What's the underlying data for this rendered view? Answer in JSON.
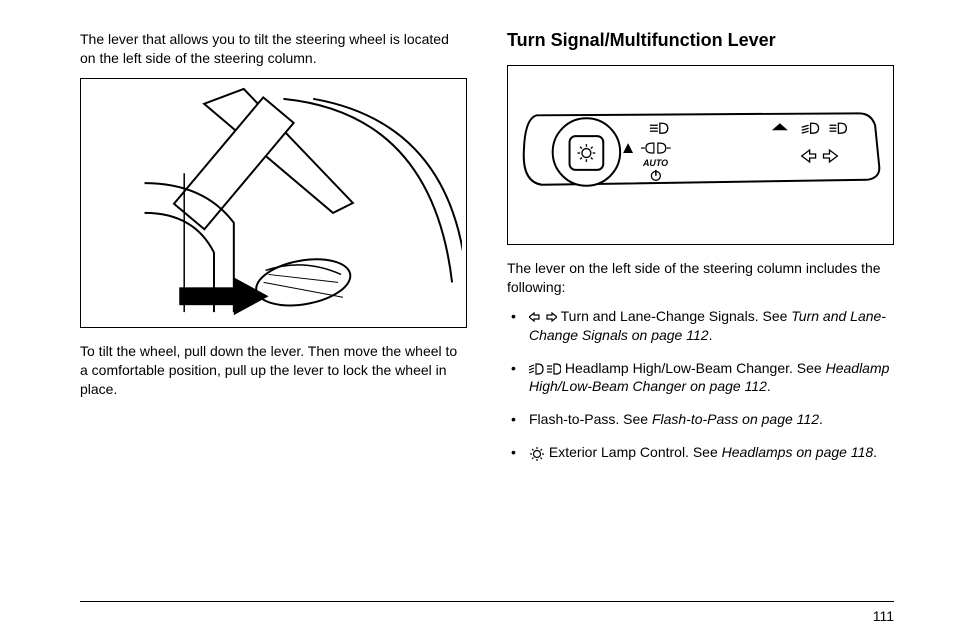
{
  "left": {
    "intro": "The lever that allows you to tilt the steering wheel is located on the left side of the steering column.",
    "caption": "To tilt the wheel, pull down the lever. Then move the wheel to a comfortable position, pull up the lever to lock the wheel in place."
  },
  "right": {
    "heading": "Turn Signal/Multifunction Lever",
    "lead": "The lever on the left side of the steering column includes the following:",
    "bullets": [
      {
        "icon": "turn-arrows",
        "text_before": "Turn and Lane-Change Signals. See ",
        "italic": "Turn and Lane-Change Signals on page 112",
        "text_after": "."
      },
      {
        "icon": "beams",
        "text_before": "Headlamp High/Low-Beam Changer. See ",
        "italic": "Headlamp High/Low-Beam Changer on page 112",
        "text_after": "."
      },
      {
        "icon": "",
        "text_before": "Flash-to-Pass. See ",
        "italic": "Flash-to-Pass on page 112",
        "text_after": "."
      },
      {
        "icon": "lamp",
        "text_before": "Exterior Lamp Control. See ",
        "italic": "Headlamps on page 118",
        "text_after": "."
      }
    ],
    "dial_label": "AUTO"
  },
  "page_number": "111"
}
